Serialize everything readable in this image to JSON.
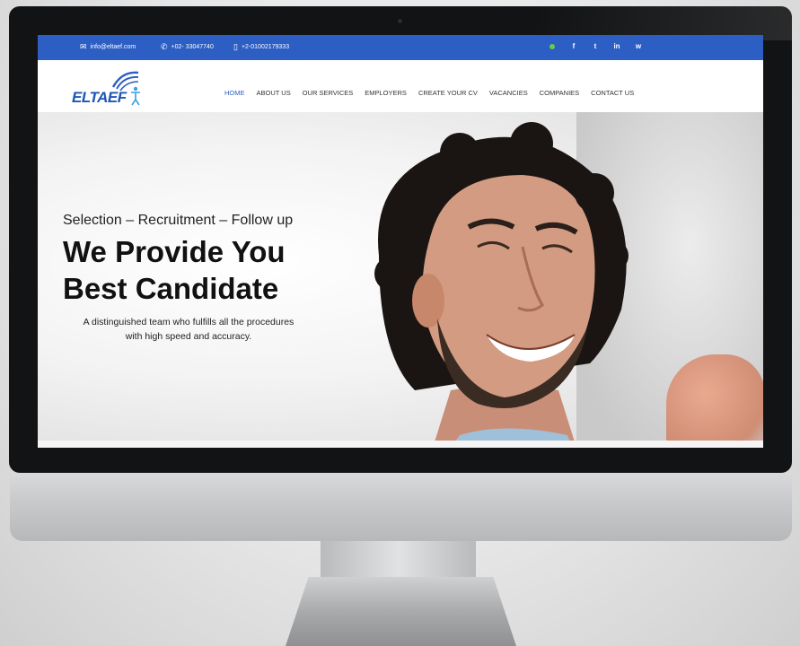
{
  "topbar": {
    "email": "info@eltaef.com",
    "phone": "+02- 33047740",
    "mobile": "+2-01002179333",
    "social": [
      "f",
      "t",
      "in",
      "w"
    ],
    "bg": "#2c5ec4"
  },
  "brand": {
    "name": "ELTAEF"
  },
  "nav": {
    "items": [
      "HOME",
      "ABOUT US",
      "OUR SERVICES",
      "EMPLOYERS",
      "CREATE YOUR CV",
      "VACANCIES",
      "COMPANIES",
      "CONTACT US"
    ],
    "active": "HOME",
    "accent": "#2c5ec4"
  },
  "hero": {
    "tagline": "Selection – Recruitment – Follow up",
    "headline_line1": "We Provide You",
    "headline_line2": "Best Candidate",
    "subtext_line1": "A distinguished team who fulfills all the procedures",
    "subtext_line2": "with high speed and accuracy."
  }
}
